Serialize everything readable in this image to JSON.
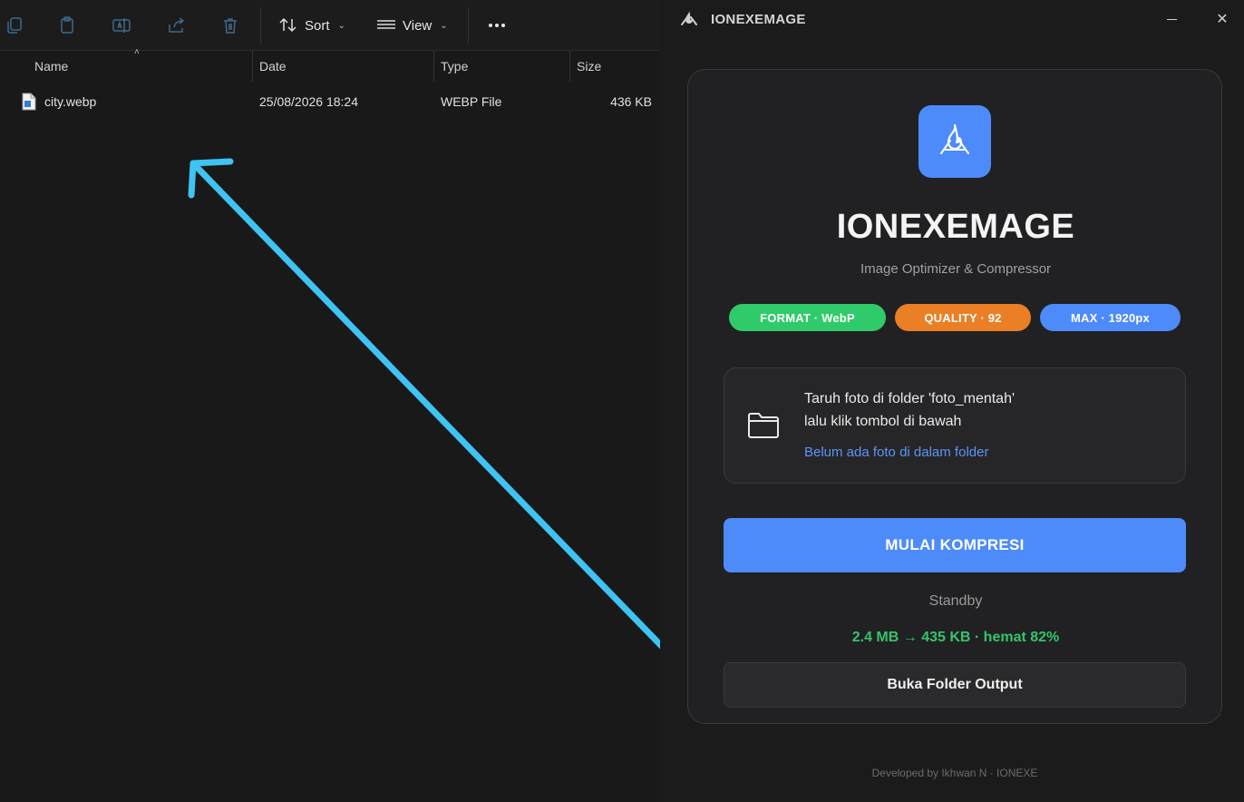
{
  "explorer": {
    "toolbar": {
      "sort_label": "Sort",
      "view_label": "View"
    },
    "columns": {
      "name": "Name",
      "date": "Date",
      "type": "Type",
      "size": "Size"
    },
    "files": [
      {
        "name": "city.webp",
        "date": "25/08/2026 18:24",
        "type": "WEBP File",
        "size": "436 KB"
      }
    ],
    "annotation_arrow_color": "#3ec3f2"
  },
  "app": {
    "window_title": "IONEXEMAGE",
    "name": "IONEXEMAGE",
    "subtitle": "Image Optimizer & Compressor",
    "badges": [
      {
        "label": "FORMAT · WebP",
        "color": "#2fcb6a"
      },
      {
        "label": "QUALITY · 92",
        "color": "#ea7f25"
      },
      {
        "label": "MAX · 1920px",
        "color": "#4d8bfb"
      }
    ],
    "dropzone": {
      "line1": "Taruh foto di folder 'foto_mentah'",
      "line2": "lalu klik tombol di bawah",
      "status": "Belum ada foto di dalam folder"
    },
    "start_button": "MULAI KOMPRESI",
    "status": "Standby",
    "result": "2.4 MB → 435 KB  ·  hemat 82%",
    "open_folder_button": "Buka Folder Output",
    "footer": "Developed by Ikhwan N · IONEXE",
    "accent_color": "#4d8bfb"
  }
}
